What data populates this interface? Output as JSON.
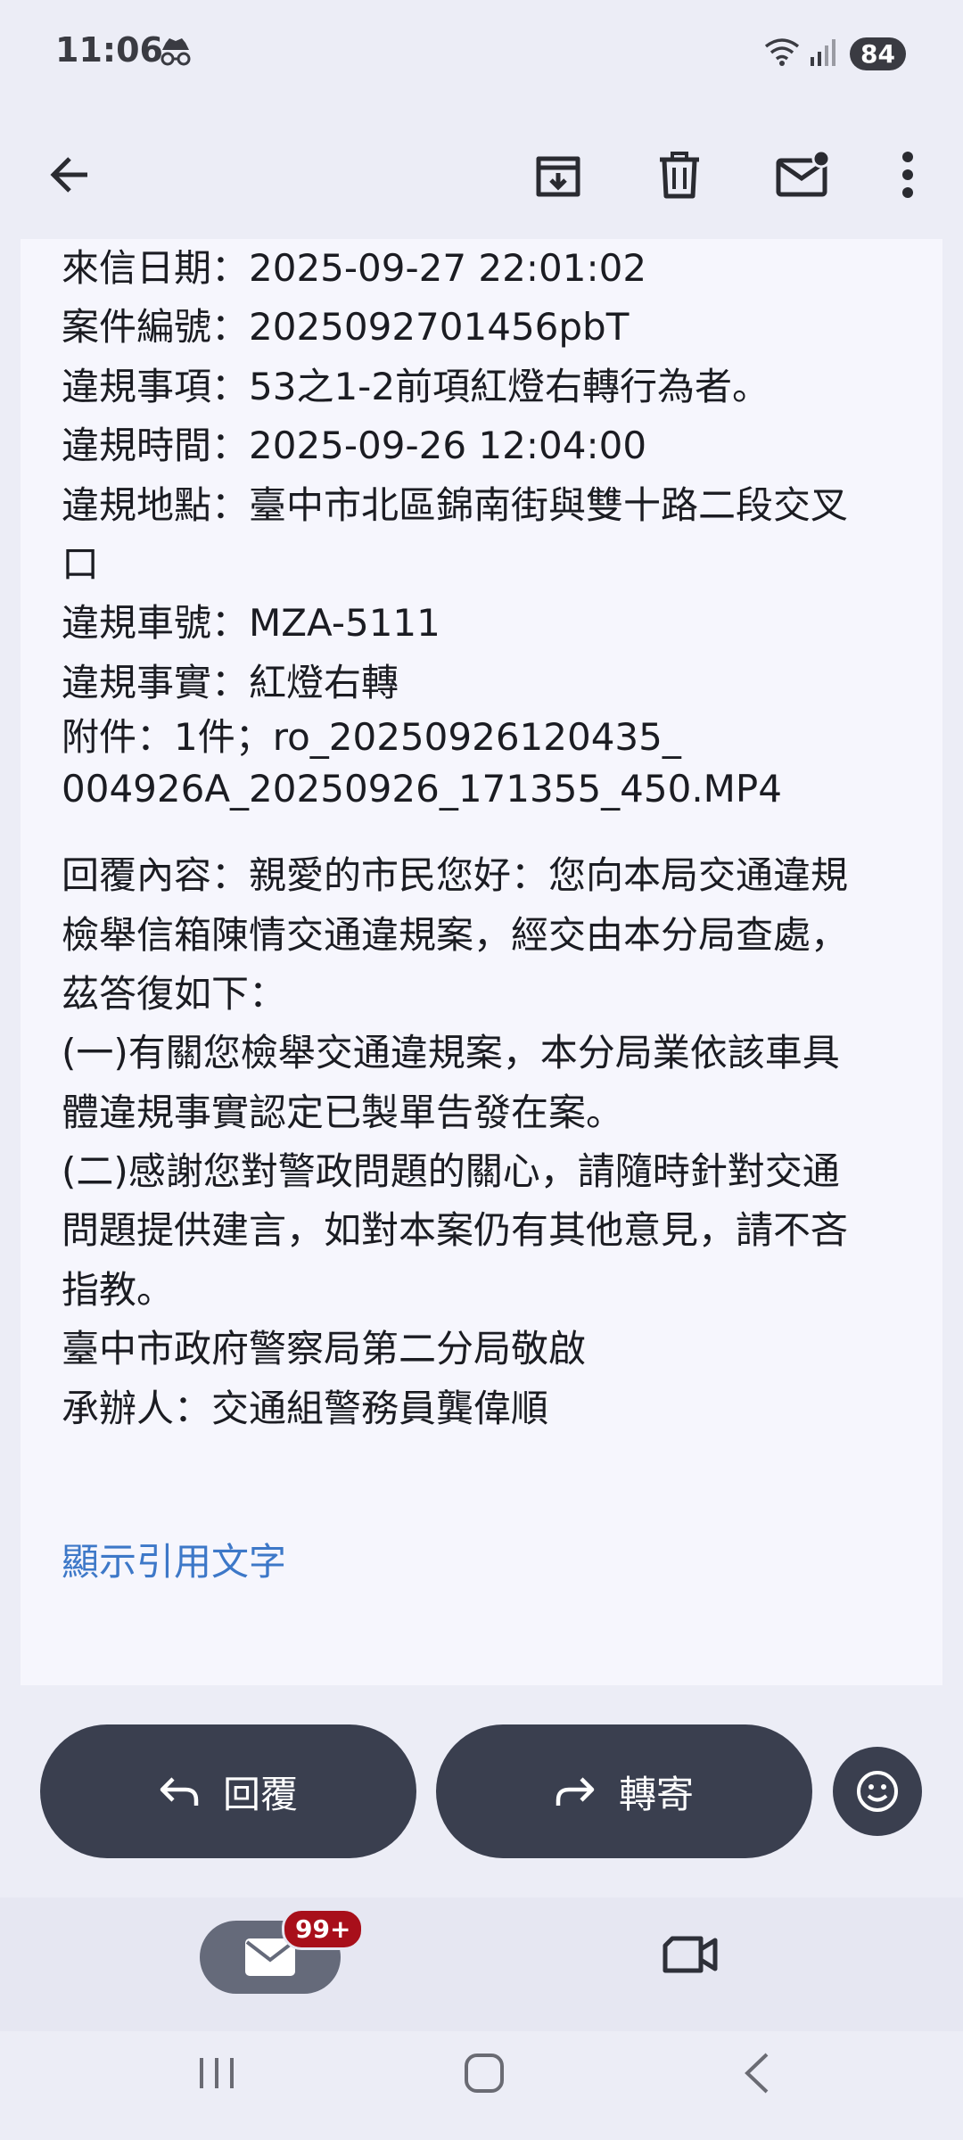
{
  "status_bar": {
    "time": "11:06",
    "battery": "84",
    "icons": [
      "incognito-icon",
      "wifi-icon",
      "signal-icon"
    ]
  },
  "toolbar": {
    "icons": [
      "back-arrow-icon",
      "archive-icon",
      "trash-icon",
      "mark-unread-icon",
      "more-vert-icon"
    ]
  },
  "message": {
    "lines": [
      "來信日期：2025-09-27 22:01:02",
      "案件編號：2025092701456pbT",
      "違規事項：53之1-2前項紅燈右轉行為者。",
      "違規時間：2025-09-26 12:04:00",
      "違規地點：臺中市北區錦南街與雙十路二段交叉",
      "口",
      "違規車號：MZA-5111",
      "違規事實：紅燈右轉",
      "附件：1件；ro_20250926120435_",
      "004926A_20250926_171355_450.MP4",
      "回覆內容：親愛的市民您好：您向本局交通違規",
      "檢舉信箱陳情交通違規案，經交由本分局查處，",
      "茲答復如下：",
      "(一)有關您檢舉交通違規案，本分局業依該車具",
      "體違規事實認定已製單告發在案。",
      "(二)感謝您對警政問題的關心，請隨時針對交通",
      "問題提供建言，如對本案仍有其他意見，請不吝",
      "指教。",
      "臺中市政府警察局第二分局敬啟",
      "承辦人：交通組警務員龔偉順"
    ],
    "show_quoted": "顯示引用文字"
  },
  "actions": {
    "reply": "回覆",
    "forward": "轉寄"
  },
  "bottom_nav": {
    "mail_badge": "99+"
  },
  "colors": {
    "background": "#ecedf6",
    "card": "#f6f6fd",
    "pill": "#3a3f4f",
    "link": "#3d78c8",
    "badge": "#a80f1a"
  }
}
